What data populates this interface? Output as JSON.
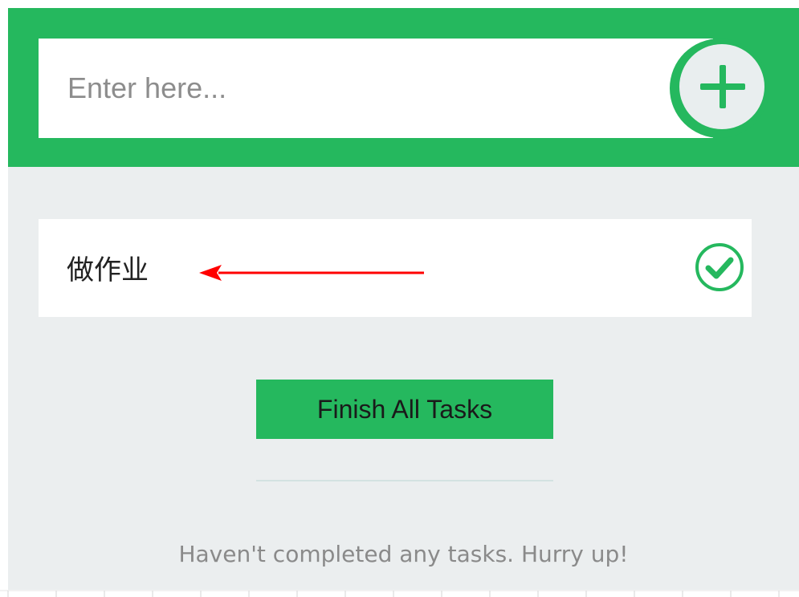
{
  "input": {
    "placeholder": "Enter here...",
    "value": ""
  },
  "add_button": {
    "icon": "plus-icon"
  },
  "tasks": [
    {
      "text": "做作业",
      "action_icon": "check-circle-icon"
    }
  ],
  "finish_button": {
    "label": "Finish All Tasks"
  },
  "status": {
    "text": "Haven't completed any tasks. Hurry up!"
  },
  "annotation": {
    "icon": "red-arrow-icon",
    "color": "#ff0000"
  },
  "colors": {
    "accent": "#25b85e",
    "background": "#ebeeef",
    "card": "#ffffff"
  }
}
